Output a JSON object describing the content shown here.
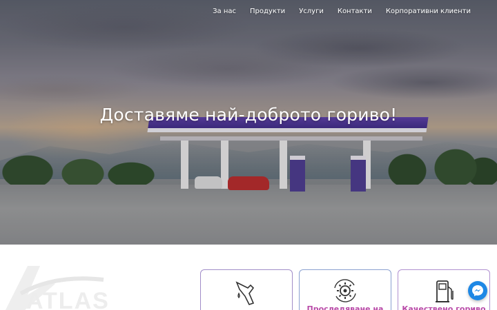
{
  "nav": {
    "items": [
      {
        "label": "За нас"
      },
      {
        "label": "Продукти"
      },
      {
        "label": "Услуги"
      },
      {
        "label": "Контакти"
      },
      {
        "label": "Корпоративни клиенти"
      }
    ]
  },
  "hero": {
    "title": "Доставяме най-доброто гориво!"
  },
  "brand": {
    "logo_text": "ATLAS"
  },
  "cards": [
    {
      "label": "",
      "icon": "fuel-nozzle-icon"
    },
    {
      "label": "Проследяване на",
      "icon": "gear-refresh-icon"
    },
    {
      "label": "Качествено гориво",
      "icon": "fuel-pump-icon"
    }
  ],
  "colors": {
    "accent_purple": "#4b2f99",
    "card_label": "#b94aa8",
    "messenger_blue": "#1e88e5"
  },
  "widgets": {
    "messenger": "messenger-icon"
  }
}
